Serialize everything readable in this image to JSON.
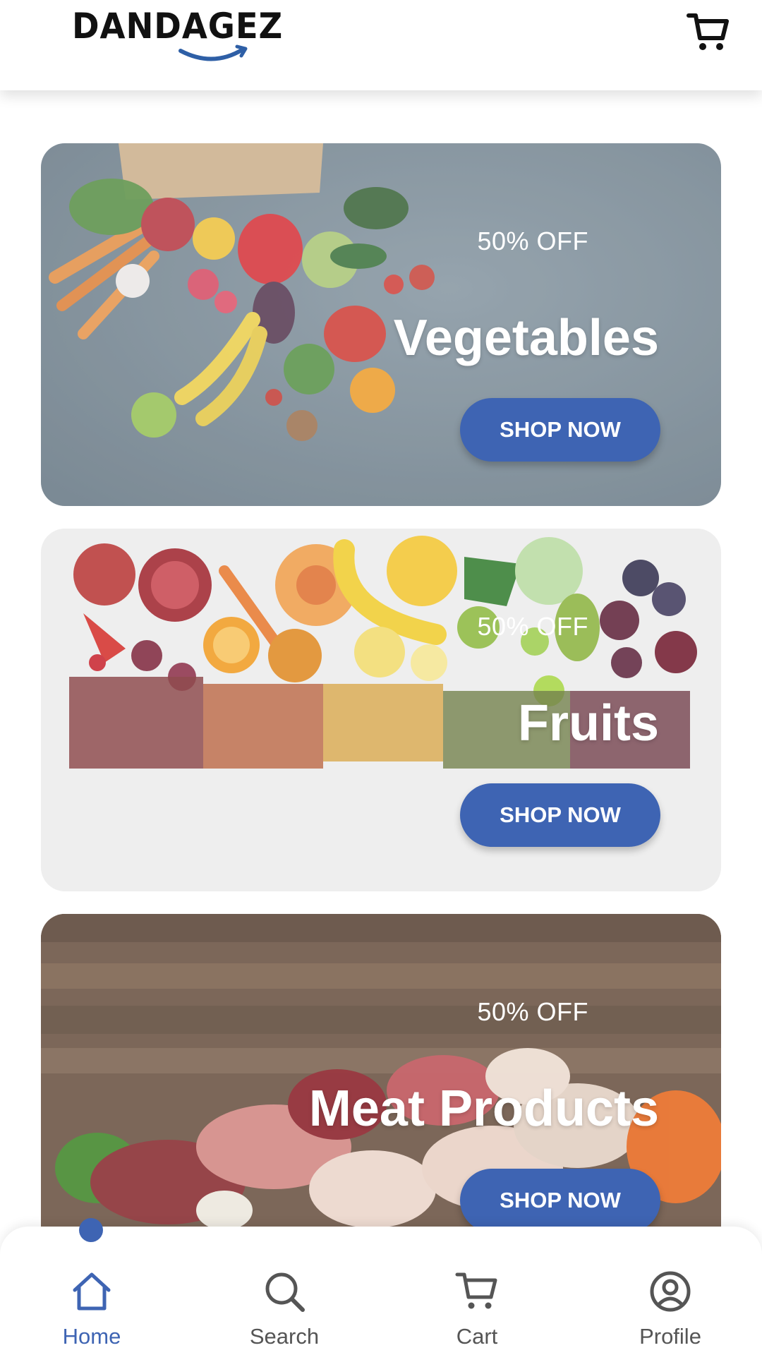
{
  "header": {
    "logo_text": "DANDAGEZ",
    "cart_icon": "cart-icon"
  },
  "banners": [
    {
      "discount": "50% OFF",
      "title": "Vegetables",
      "button": "SHOP NOW",
      "image": "assorted vegetables on grey stone background"
    },
    {
      "discount": "50% OFF",
      "title": "Fruits",
      "button": "SHOP NOW",
      "image": "rainbow of fruits and dried fruit pieces on white background"
    },
    {
      "discount": "50% OFF",
      "title": "Meat Products",
      "button": "SHOP NOW",
      "image": "raw meats and chicken on wooden table"
    }
  ],
  "bottom_nav": {
    "items": [
      {
        "label": "Home",
        "icon": "home-icon",
        "active": true
      },
      {
        "label": "Search",
        "icon": "search-icon",
        "active": false
      },
      {
        "label": "Cart",
        "icon": "cart-icon",
        "active": false
      },
      {
        "label": "Profile",
        "icon": "profile-icon",
        "active": false
      }
    ]
  },
  "colors": {
    "accent": "#3e64b3",
    "nav_inactive": "#555555",
    "text_on_banner": "#ffffff"
  }
}
